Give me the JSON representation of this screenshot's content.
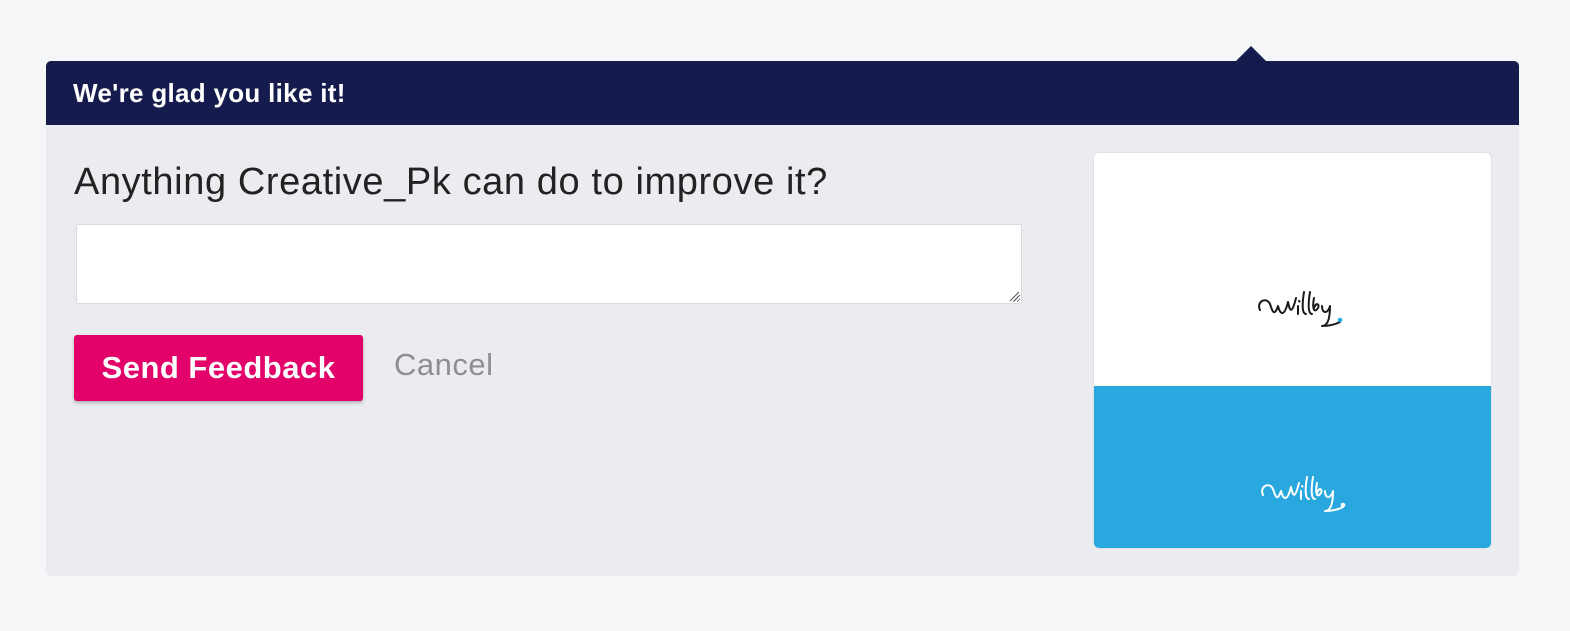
{
  "header": {
    "title": "We're glad you like it!"
  },
  "form": {
    "question": "Anything Creative_Pk can do to improve it?",
    "feedback_value": "",
    "feedback_placeholder": "",
    "send_label": "Send Feedback",
    "cancel_label": "Cancel"
  },
  "preview": {
    "logo_text": "Wilby",
    "top_background": "#ffffff",
    "bottom_background": "#29a8e0",
    "accent_dot_color": "#29a8e0"
  },
  "colors": {
    "header_bg": "#151c4d",
    "primary_button": "#e2026a",
    "panel_bg": "#ebecf0"
  }
}
